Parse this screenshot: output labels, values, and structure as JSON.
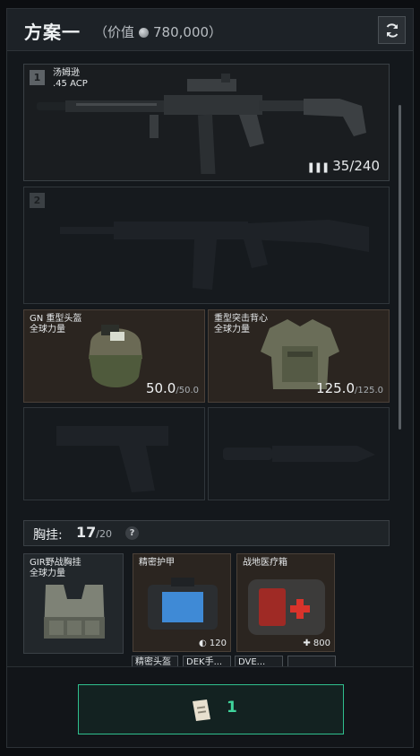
{
  "header": {
    "title": "方案一",
    "value_prefix": "（价值",
    "value": "780,000）",
    "refresh_icon": "refresh-icon"
  },
  "slots": {
    "primary": {
      "number": "1",
      "name": "汤姆逊",
      "ammo_type": ".45 ACP",
      "ammo": "35/240"
    },
    "secondary": {
      "number": "2"
    },
    "helmet": {
      "name": "GN 重型头盔",
      "sub": "全球力量",
      "durability": "50.0",
      "durability_max": "/50.0"
    },
    "armor": {
      "name": "重型突击背心",
      "sub": "全球力量",
      "durability": "125.0",
      "durability_max": "/125.0"
    }
  },
  "rig": {
    "label": "胸挂:",
    "count": "17",
    "max": "/20",
    "help": "?",
    "items": [
      {
        "name": "GIR野战胸挂",
        "sub": "全球力量"
      },
      {
        "name": "精密护甲",
        "badge": "120"
      },
      {
        "name": "战地医疗箱",
        "badge": "800"
      }
    ],
    "sub_slots": [
      "精密头盔",
      "DEK手...",
      "DVE..."
    ]
  },
  "footer": {
    "count": "1"
  }
}
